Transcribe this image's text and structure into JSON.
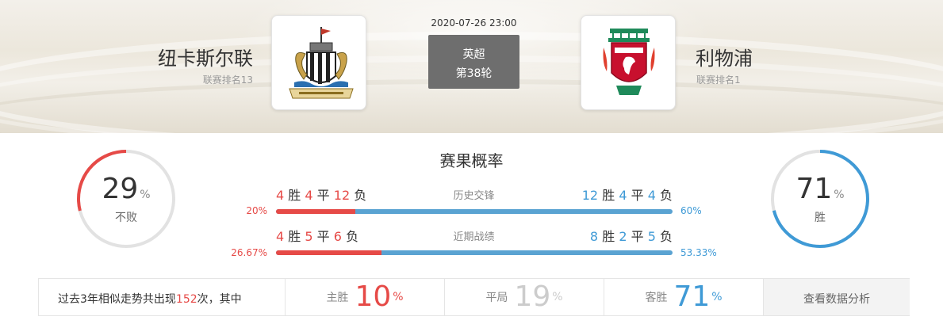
{
  "match": {
    "time": "2020-07-26 23:00",
    "league": "英超",
    "round": "第38轮"
  },
  "home": {
    "name": "纽卡斯尔联",
    "rank": "联赛排名13",
    "logo_icon": "newcastle-crest-icon"
  },
  "away": {
    "name": "利物浦",
    "rank": "联赛排名1",
    "logo_icon": "liverpool-crest-icon"
  },
  "probability": {
    "title": "赛果概率",
    "home": {
      "value": "29",
      "unit": "%",
      "label": "不败",
      "fraction": 0.29
    },
    "away": {
      "value": "71",
      "unit": "%",
      "label": "胜",
      "fraction": 0.71
    },
    "rows": [
      {
        "title": "历史交锋",
        "home": {
          "w": "4",
          "w_label": "胜",
          "d": "4",
          "d_label": "平",
          "l": "12",
          "l_label": "负"
        },
        "away": {
          "w": "12",
          "w_label": "胜",
          "d": "4",
          "d_label": "平",
          "l": "4",
          "l_label": "负"
        },
        "home_pct": "20%",
        "away_pct": "60%",
        "home_fraction": 0.2
      },
      {
        "title": "近期战绩",
        "home": {
          "w": "4",
          "w_label": "胜",
          "d": "5",
          "d_label": "平",
          "l": "6",
          "l_label": "负"
        },
        "away": {
          "w": "8",
          "w_label": "胜",
          "d": "2",
          "d_label": "平",
          "l": "5",
          "l_label": "负"
        },
        "home_pct": "26.67%",
        "away_pct": "53.33%",
        "home_fraction": 0.2667
      }
    ]
  },
  "summary": {
    "prefix": "过去3年相似走势共出现",
    "count": "152",
    "suffix": "次，其中",
    "home_win": {
      "label": "主胜",
      "value": "10",
      "unit": "%"
    },
    "draw": {
      "label": "平局",
      "value": "19",
      "unit": "%"
    },
    "away_win": {
      "label": "客胜",
      "value": "71",
      "unit": "%"
    },
    "button": "查看数据分析"
  },
  "colors": {
    "red": "#e64a47",
    "blue": "#3f9ad6",
    "ring_track": "#e2e2e2",
    "league_box": "#6e6e6e"
  }
}
